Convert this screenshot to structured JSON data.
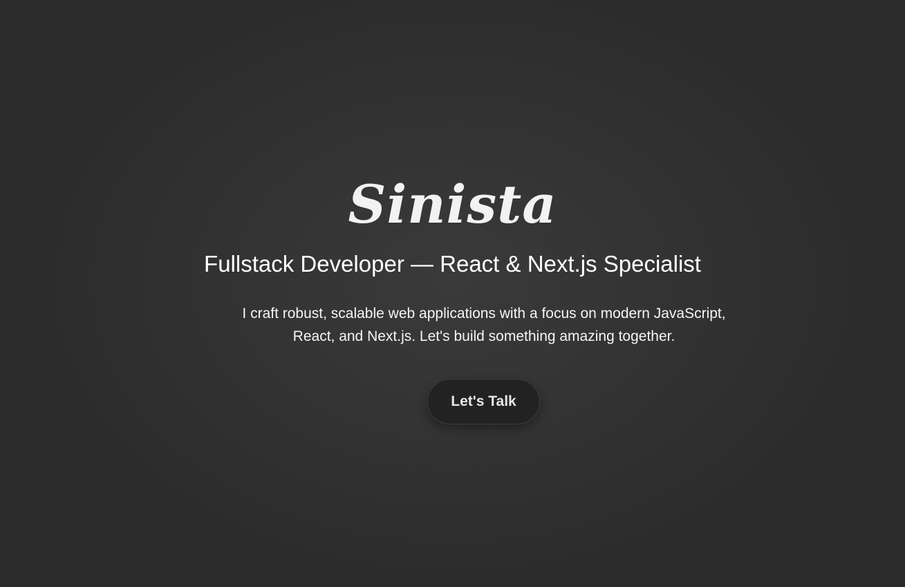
{
  "hero": {
    "logo_text": "Sinista",
    "headline": "Fullstack Developer — React & Next.js Specialist",
    "bio_line_1": "I craft robust, scalable web applications with a focus on modern JavaScript,",
    "bio_line_2": "React, and Next.js. Let's build something amazing together.",
    "cta_label": "Let's Talk"
  },
  "colors": {
    "background": "#333333",
    "text": "#ffffff",
    "button_bg": "#222222",
    "button_text": "#e6e6e6"
  }
}
